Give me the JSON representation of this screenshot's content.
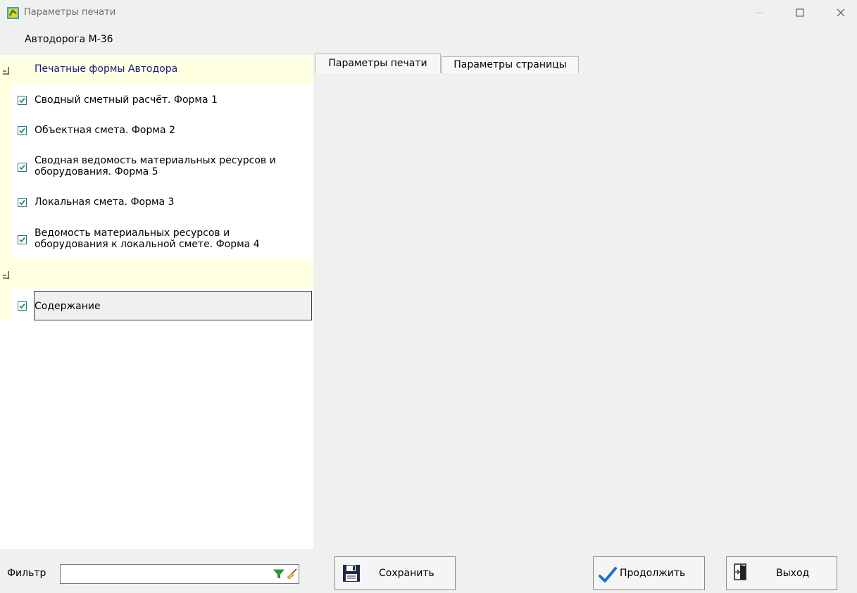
{
  "window": {
    "title": "Параметры печати"
  },
  "project": {
    "name": "Автодорога М-36"
  },
  "tree": {
    "group1_label": "Печатные формы Автодора",
    "group1_items": [
      {
        "label": "Сводный сметный расчёт. Форма 1",
        "checked": true
      },
      {
        "label": "Объектная смета. Форма 2",
        "checked": true
      },
      {
        "label": "Сводная ведомость материальных ресурсов и",
        "label2": "оборудования. Форма 5",
        "checked": true
      },
      {
        "label": "Локальная смета. Форма 3",
        "checked": true
      },
      {
        "label": "Ведомость материальных ресурсов и",
        "label2": "оборудования к локальной смете. Форма 4",
        "checked": true
      }
    ],
    "group2_label": "",
    "group2_items": [
      {
        "label": "Содержание",
        "checked": true
      }
    ]
  },
  "tabs": [
    {
      "label": "Параметры печати",
      "active": true
    },
    {
      "label": "Параметры страницы",
      "active": false
    }
  ],
  "filter": {
    "label": "Фильтр",
    "value": ""
  },
  "buttons": {
    "save_label": "Сохранить",
    "continue_label": "Продолжить",
    "exit_label": "Выход"
  },
  "colors": {
    "tree_highlight": "#ffffe1",
    "group_text": "#1a1a8c",
    "check_green": "#1f9a2f",
    "checkmark_blue": "#1c6fd1"
  }
}
